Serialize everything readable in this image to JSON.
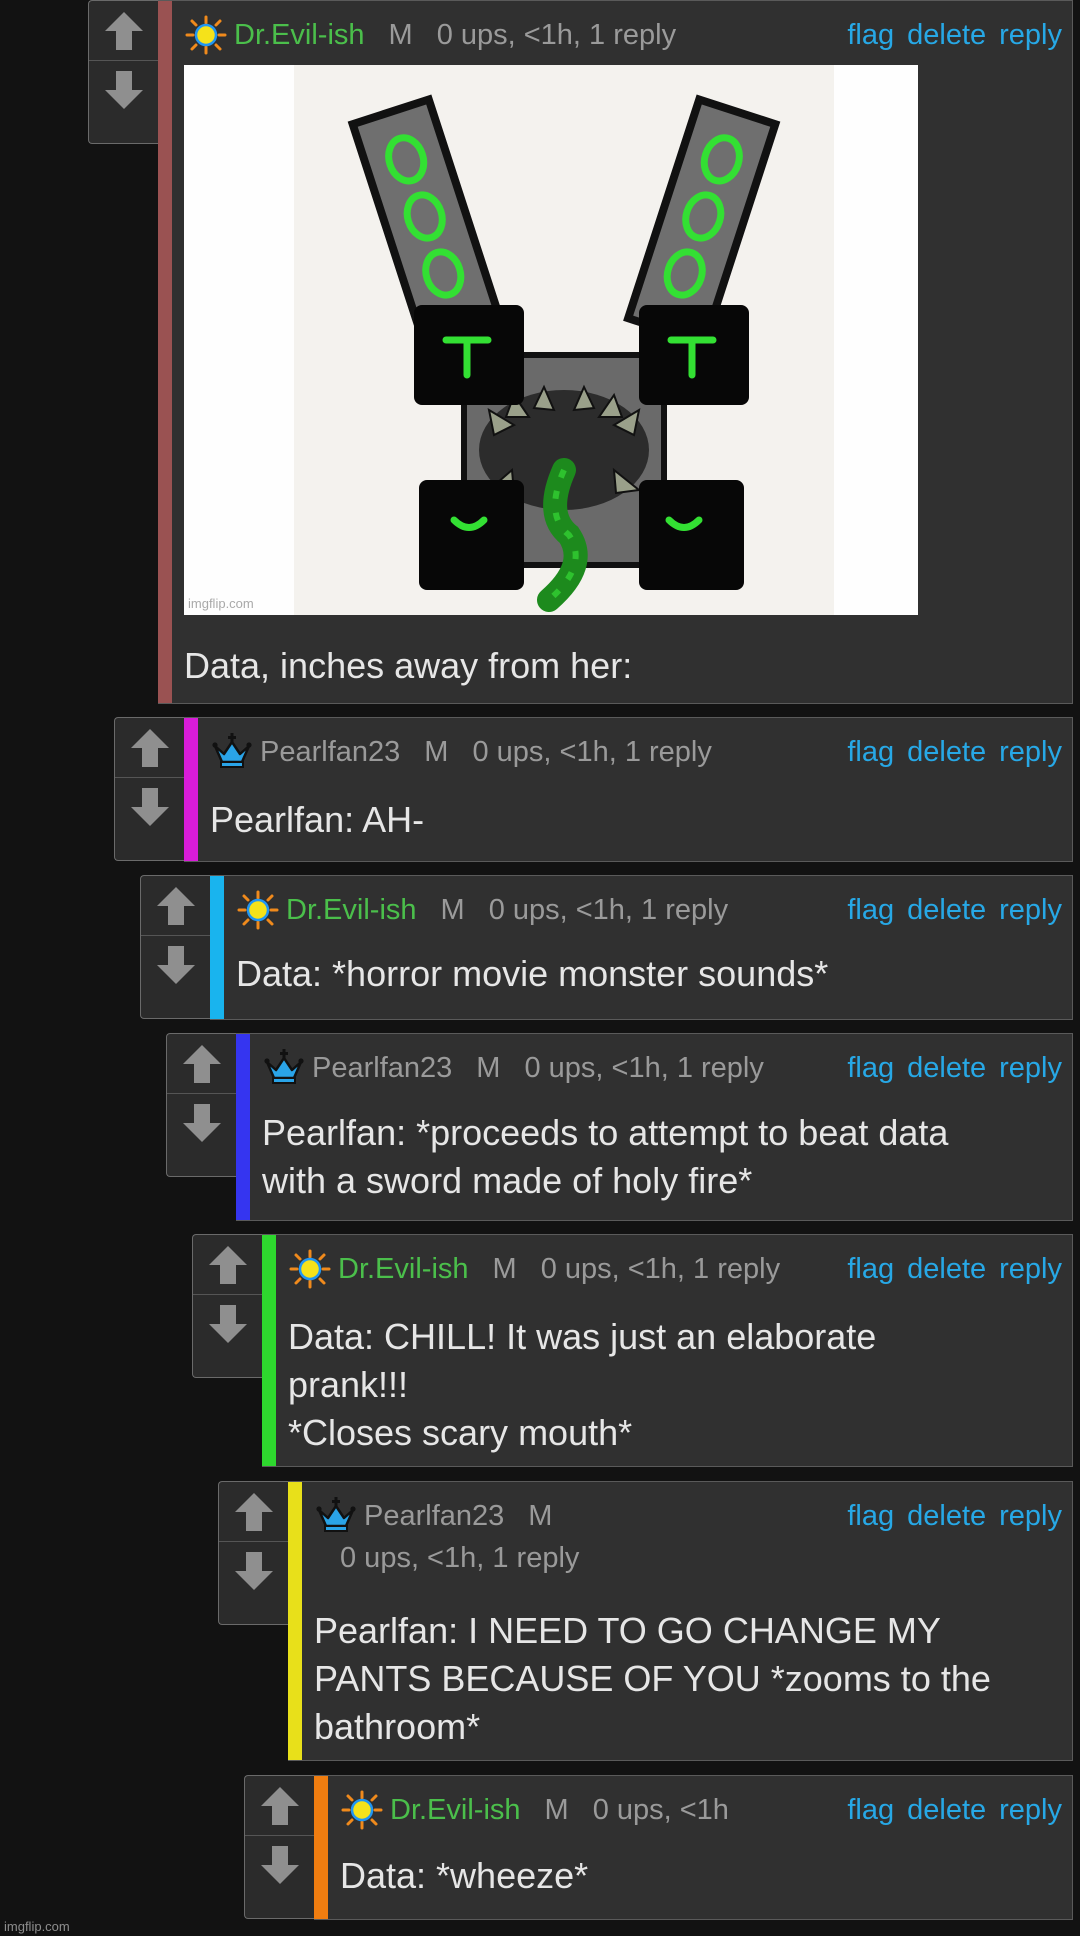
{
  "icons": {
    "upvote": "up-arrow-icon",
    "downvote": "down-arrow-icon",
    "sun_avatar": "sun-icon",
    "crown_avatar": "crown-icon"
  },
  "colors": {
    "link": "#27a8e6",
    "green_user": "#4bbf4b",
    "grey_text": "#9a9a9a"
  },
  "comments": [
    {
      "username": "Dr.Evil-ish",
      "mod": "M",
      "stats": "0 ups, <1h, 1 reply",
      "actions": {
        "flag": "flag",
        "delete": "delete",
        "reply": "reply"
      },
      "image_watermark": "imgflip.com",
      "text": "Data, inches away from her:",
      "bar_color": "#9a5252"
    },
    {
      "username": "Pearlfan23",
      "mod": "M",
      "stats": "0 ups, <1h, 1 reply",
      "actions": {
        "flag": "flag",
        "delete": "delete",
        "reply": "reply"
      },
      "text": "Pearlfan: AH-",
      "bar_color": "#d81cd8"
    },
    {
      "username": "Dr.Evil-ish",
      "mod": "M",
      "stats": "0 ups, <1h, 1 reply",
      "actions": {
        "flag": "flag",
        "delete": "delete",
        "reply": "reply"
      },
      "text": "Data: *horror movie monster sounds*",
      "bar_color": "#19b4ee"
    },
    {
      "username": "Pearlfan23",
      "mod": "M",
      "stats": "0 ups, <1h, 1 reply",
      "actions": {
        "flag": "flag",
        "delete": "delete",
        "reply": "reply"
      },
      "text": "Pearlfan: *proceeds to attempt to beat data\nwith a sword made of holy fire*",
      "bar_color": "#3535f0"
    },
    {
      "username": "Dr.Evil-ish",
      "mod": "M",
      "stats": "0 ups, <1h, 1 reply",
      "actions": {
        "flag": "flag",
        "delete": "delete",
        "reply": "reply"
      },
      "text": "Data: CHILL! It was just an elaborate\nprank!!!\n*Closes scary mouth*",
      "bar_color": "#2ed82e"
    },
    {
      "username": "Pearlfan23",
      "mod": "M",
      "stats": "0 ups, <1h, 1 reply",
      "actions": {
        "flag": "flag",
        "delete": "delete",
        "reply": "reply"
      },
      "text": "Pearlfan: I NEED TO GO CHANGE MY\nPANTS BECAUSE OF YOU *zooms to the\nbathroom*",
      "bar_color": "#e8e01a"
    },
    {
      "username": "Dr.Evil-ish",
      "mod": "M",
      "stats": "0 ups, <1h",
      "actions": {
        "flag": "flag",
        "delete": "delete",
        "reply": "reply"
      },
      "text": "Data: *wheeze*",
      "bar_color": "#f07d10"
    }
  ],
  "site_watermark": "imgflip.com"
}
